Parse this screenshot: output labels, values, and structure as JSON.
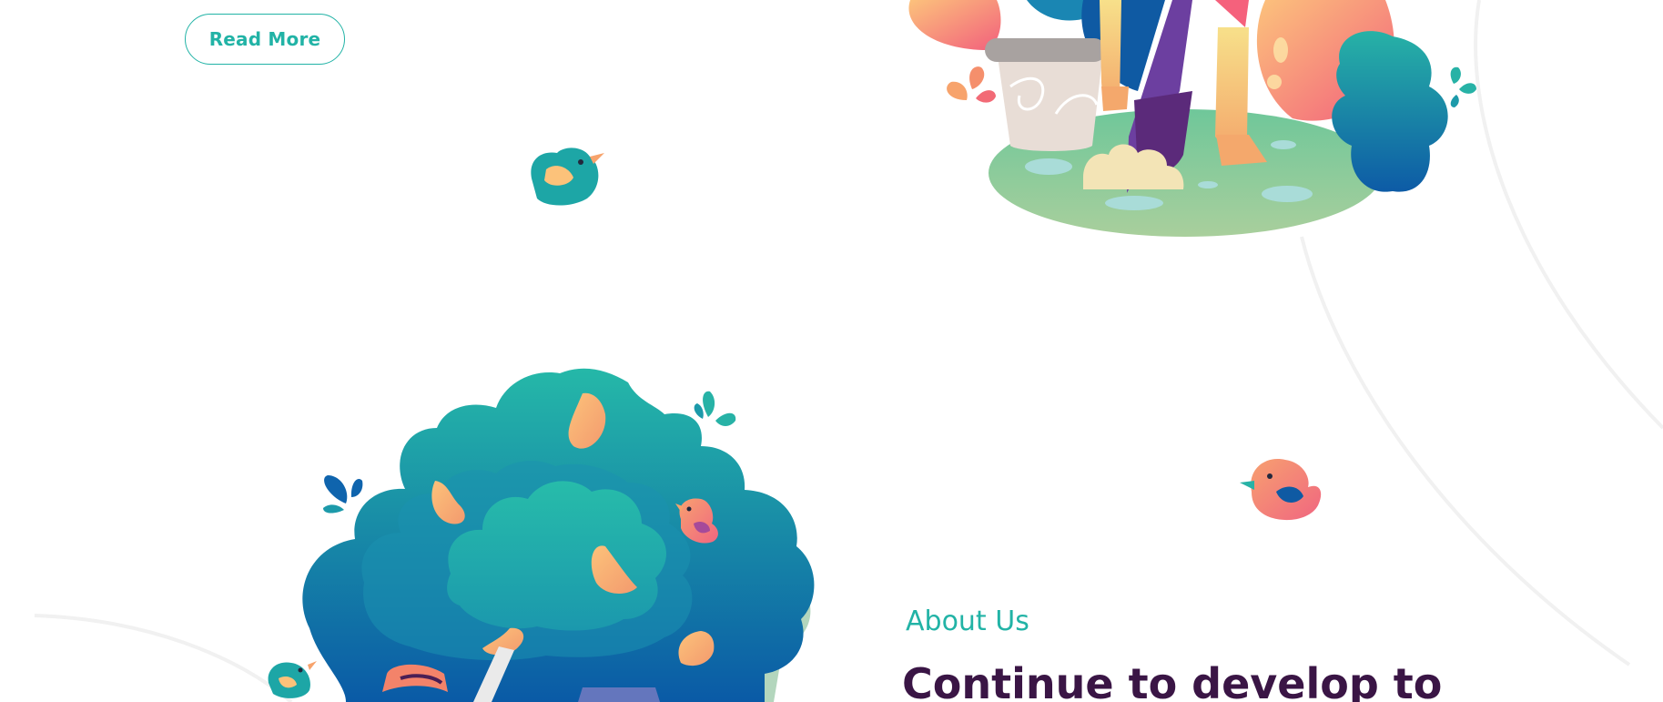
{
  "hero": {
    "read_more_label": "Read More"
  },
  "about": {
    "label": "About Us",
    "heading": "Continue to develop to"
  },
  "colors": {
    "accent": "#22b3a6",
    "heading": "#3a1545",
    "line": "#f1f1f1"
  }
}
